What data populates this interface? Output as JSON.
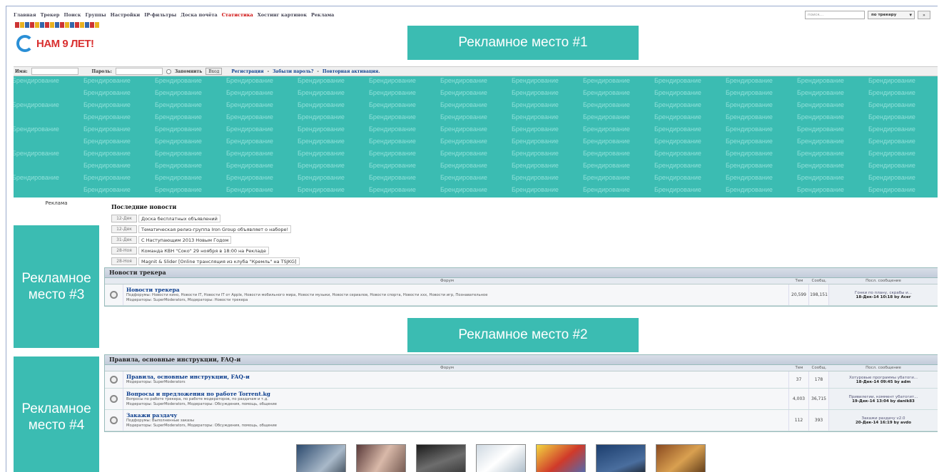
{
  "nav": {
    "items": [
      "Главная",
      "Трекер",
      "Поиск",
      "Группы",
      "Настройки",
      "IP-фильтры",
      "Доска почёта",
      "Статистика",
      "Хостинг картинок",
      "Реклама"
    ],
    "search_placeholder": "поиск...",
    "search_scope": "по трекеру",
    "search_go": "»"
  },
  "logo": {
    "text": "НАМ 9 ЛЕТ!"
  },
  "login": {
    "name_label": "Имя:",
    "password_label": "Пароль:",
    "remember_label": "Запомнить",
    "submit_label": "Вход",
    "register_link": "Регистрация",
    "forgot_link": "Забыли пароль?",
    "resend_link": "Повторная активация."
  },
  "ads": {
    "ad1": "Рекламное место #1",
    "ad2": "Рекламное место #2",
    "ad3": "Рекламное место #3",
    "ad4": "Рекламное место #4"
  },
  "branding_word": "Брендирование",
  "sidebar_label": "Реклама",
  "news": {
    "title": "Последние новости",
    "items": [
      {
        "date": "12-Дек",
        "text": "Доска бесплатных объявлений"
      },
      {
        "date": "12-Дек",
        "text": "Тематическая релиз-группа Iron Group объявляет о наборе!"
      },
      {
        "date": "31-Дек",
        "text": "С Наступающим 2013 Новым Годом"
      },
      {
        "date": "28-Ноя",
        "text": "Команда КВН \"Соко\" 29 ноября в 18:00 на Рекладе"
      },
      {
        "date": "28-Ноя",
        "text": "Magnit & Slider [Online трансляция из клуба \"Кремль\" на TSJKG]"
      }
    ]
  },
  "table_headers": {
    "forum": "Форум",
    "topics": "Тем",
    "posts": "Сообщ.",
    "last": "Посл. сообщение"
  },
  "sections": [
    {
      "title": "Новости трекера",
      "forums": [
        {
          "name": "Новости трекера",
          "sub": "Подфорумы: Новости кино, Новости IT, Новости IT от Apple, Новости мобильного мира, Новости музыки, Новости сериалов, Новости спорта, Новости ххх, Новости игр, Познавательное",
          "mods": "Модераторы: SuperModerators, Модераторы: Новости трекера",
          "topics": "20,599",
          "posts": "198,151",
          "last1": "Гонки по плану, скрабы и...",
          "last2": "18-Дек-14 10:18 by Acer"
        }
      ]
    },
    {
      "title": "Правила, основные инструкции, FAQ-и",
      "forums": [
        {
          "name": "Правила, основные инструкции, FAQ-и",
          "sub": "Модераторы: SuperModerators",
          "mods": "",
          "topics": "37",
          "posts": "178",
          "last1": "Хотуровые программы убатоги...",
          "last2": "18-Дек-14 09:45 by adm"
        },
        {
          "name": "Вопросы и предложения по работе Torrent.kg",
          "sub": "Вопросы по работе трекера, по работе модераторов, по раздачам и т.д.",
          "mods": "Модераторы: SuperModerators, Модераторы: Обсуждения, помощь, общение",
          "topics": "4,003",
          "posts": "36,715",
          "last1": "Привилегии, коммент убатогит...",
          "last2": "19-Дек-14 13:04 by danik83"
        },
        {
          "name": "Закажи раздачу",
          "sub": "Подфорумы: Выполненные заказы",
          "mods": "Модераторы: SuperModerators, Модераторы: Обсуждения, помощь, общение",
          "topics": "112",
          "posts": "393",
          "last1": "Закажи раздачу v2.0",
          "last2": "20-Дек-14 16:19 by avdo"
        }
      ]
    }
  ],
  "colors": {
    "accent": "#3bbcb2",
    "link": "#0a3c8c",
    "highlight": "#cc0000"
  }
}
